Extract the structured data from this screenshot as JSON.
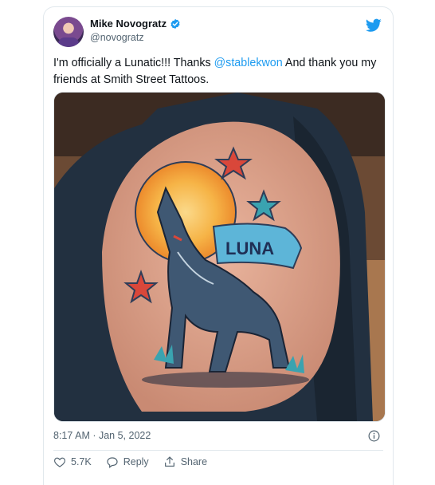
{
  "author": {
    "name": "Mike Novogratz",
    "handle": "@novogratz"
  },
  "tweet": {
    "text_before": "I'm officially a Lunatic!!!  Thanks ",
    "mention": "@stablekwon",
    "text_after": "  And thank you my friends at Smith Street Tattoos.",
    "image_banner_text": "LUNA",
    "timestamp": "8:17 AM · Jan 5, 2022"
  },
  "actions": {
    "like_count": "5.7K",
    "reply_label": "Reply",
    "share_label": "Share"
  },
  "colors": {
    "brand": "#1d9bf0",
    "text": "#0f1419",
    "muted": "#536471"
  },
  "icons": [
    "avatar",
    "verified-badge-icon",
    "twitter-logo-icon",
    "info-icon",
    "heart-icon",
    "reply-icon",
    "share-icon"
  ]
}
